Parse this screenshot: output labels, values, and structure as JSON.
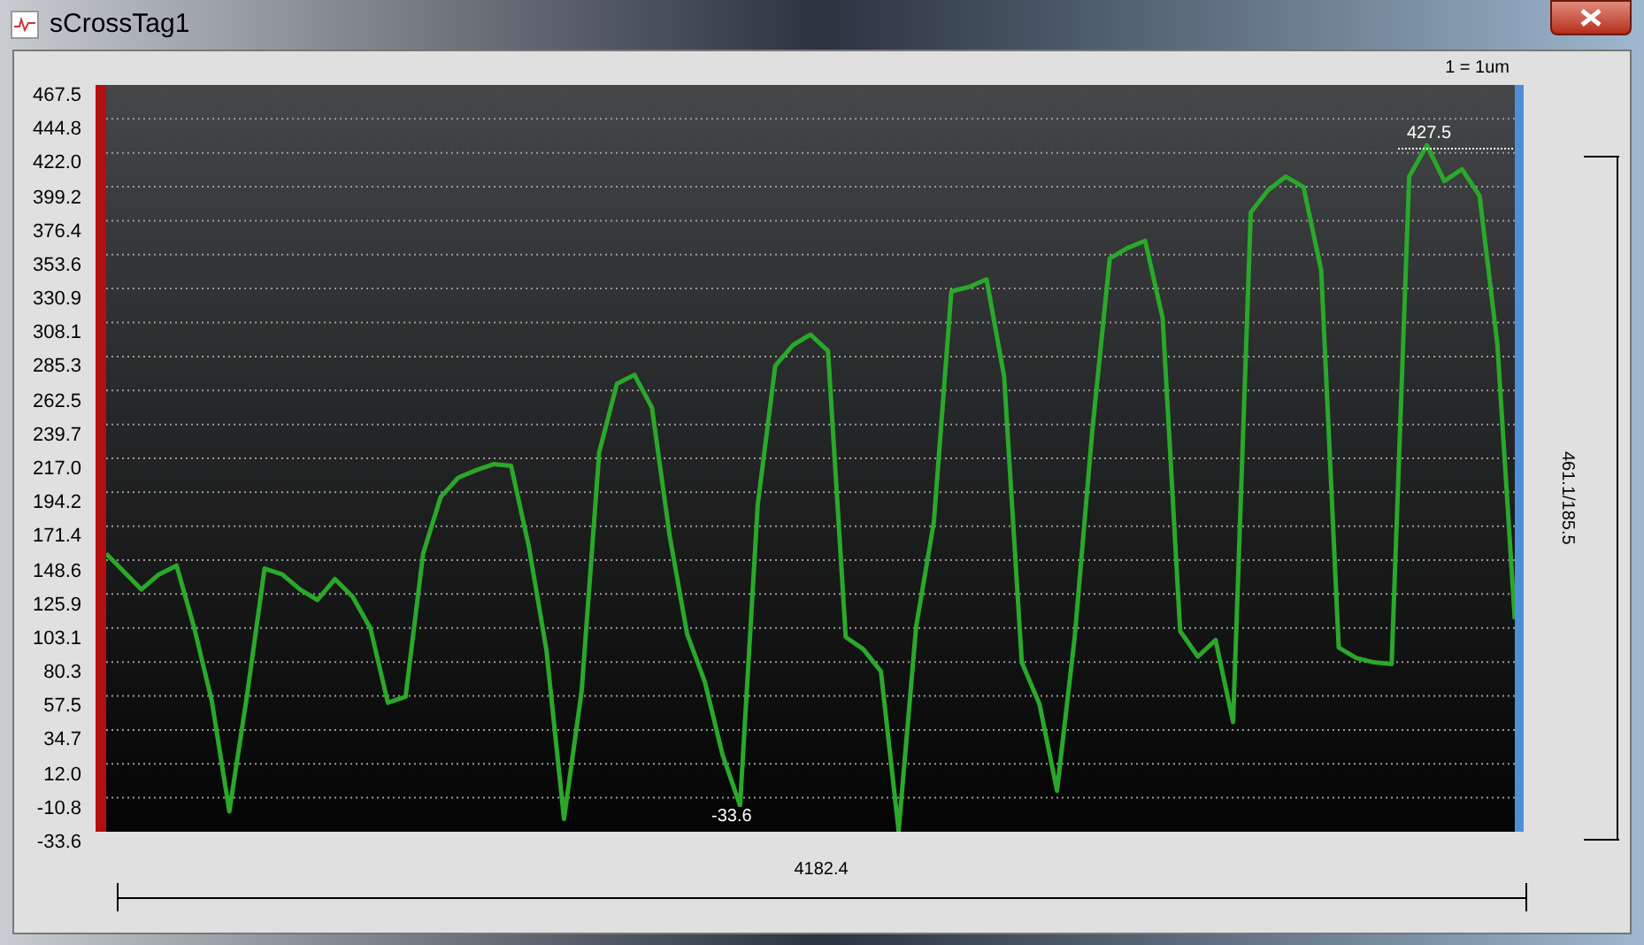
{
  "window": {
    "title": "sCrossTag1"
  },
  "scale_label": "1 = 1um",
  "chart_data": {
    "type": "line",
    "ylim": [
      -33.6,
      467.5
    ],
    "grid": true,
    "categories": [
      null,
      null,
      null,
      null,
      null,
      null,
      null,
      null,
      null,
      null,
      null,
      null,
      null,
      null,
      null,
      null,
      null,
      null,
      null,
      null,
      null,
      null,
      null,
      null,
      null,
      null,
      null,
      null,
      null,
      null,
      null,
      null,
      null,
      null,
      null,
      null,
      null,
      null,
      null,
      null,
      null,
      null,
      null,
      null,
      null,
      null,
      null,
      null,
      null,
      null,
      null,
      null,
      null,
      null,
      null,
      null,
      null,
      null,
      null,
      null,
      null,
      null,
      null,
      null,
      null,
      null,
      null,
      null,
      null,
      null,
      null,
      null,
      null,
      null,
      null,
      null,
      null,
      null,
      null,
      null,
      null
    ],
    "yticks": [
      {
        "value": 467.5,
        "label": "467.5"
      },
      {
        "value": 444.8,
        "label": "444.8"
      },
      {
        "value": 422,
        "label": "422.0"
      },
      {
        "value": 399.2,
        "label": "399.2"
      },
      {
        "value": 376.4,
        "label": "376.4"
      },
      {
        "value": 353.6,
        "label": "353.6"
      },
      {
        "value": 330.9,
        "label": "330.9"
      },
      {
        "value": 308.1,
        "label": "308.1"
      },
      {
        "value": 285.3,
        "label": "285.3"
      },
      {
        "value": 262.5,
        "label": "262.5"
      },
      {
        "value": 239.7,
        "label": "239.7"
      },
      {
        "value": 217,
        "label": "217.0"
      },
      {
        "value": 194.2,
        "label": "194.2"
      },
      {
        "value": 171.4,
        "label": "171.4"
      },
      {
        "value": 148.6,
        "label": "148.6"
      },
      {
        "value": 125.9,
        "label": "125.9"
      },
      {
        "value": 103.1,
        "label": "103.1"
      },
      {
        "value": 80.3,
        "label": "80.3"
      },
      {
        "value": 57.5,
        "label": "57.5"
      },
      {
        "value": 34.7,
        "label": "34.7"
      },
      {
        "value": 12,
        "label": "12.0"
      },
      {
        "value": -10.8,
        "label": "-10.8"
      },
      {
        "value": -33.6,
        "label": "-33.6"
      }
    ],
    "series": [
      {
        "color": "#2aa82a",
        "values": [
          153,
          141,
          129,
          139,
          145,
          103,
          54,
          -20,
          58,
          143,
          139,
          129,
          122,
          136,
          124,
          103,
          53,
          57,
          153,
          191,
          204,
          209,
          213,
          212,
          158,
          88,
          -25,
          61,
          221,
          267,
          273,
          251,
          165,
          99,
          67,
          18,
          -16,
          186,
          279,
          293,
          300,
          289,
          97,
          89,
          74,
          -33,
          104,
          174,
          329,
          332,
          337,
          272,
          80,
          52,
          -6,
          97,
          235,
          351,
          358,
          363,
          311,
          101,
          84,
          95,
          40,
          382,
          397,
          406,
          399,
          343,
          90,
          83,
          80,
          79,
          406,
          427,
          403,
          411,
          393,
          294,
          109
        ]
      }
    ]
  },
  "max_marker": "427.5",
  "min_marker": "-33.6",
  "x_span": "4182.4",
  "y_span": "461.1/185.5"
}
